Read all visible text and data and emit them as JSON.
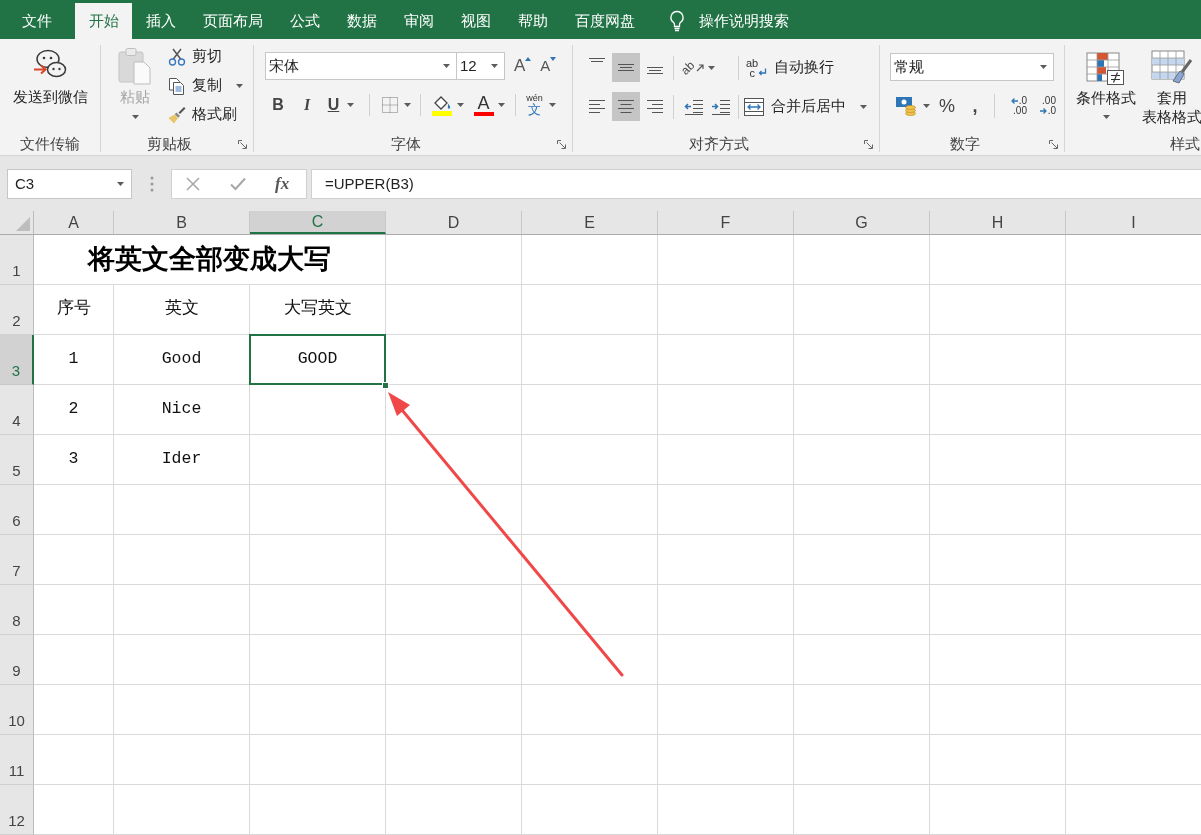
{
  "tabs": [
    {
      "label": "文件",
      "selected": false
    },
    {
      "label": "开始",
      "selected": true
    },
    {
      "label": "插入",
      "selected": false
    },
    {
      "label": "页面布局",
      "selected": false
    },
    {
      "label": "公式",
      "selected": false
    },
    {
      "label": "数据",
      "selected": false
    },
    {
      "label": "审阅",
      "selected": false
    },
    {
      "label": "视图",
      "selected": false
    },
    {
      "label": "帮助",
      "selected": false
    },
    {
      "label": "百度网盘",
      "selected": false
    }
  ],
  "tell_me": {
    "label": "操作说明搜索"
  },
  "ribbon": {
    "file_transfer": {
      "title": "文件传输",
      "send_to_wechat": "发送到微信"
    },
    "clipboard": {
      "title": "剪贴板",
      "paste": {
        "label": "粘贴",
        "disabled": true
      },
      "cut": "剪切",
      "copy": "复制",
      "format_painter": "格式刷"
    },
    "font": {
      "title": "字体",
      "font_name": "宋体",
      "font_size": "12",
      "grow_font": "A",
      "shrink_font": "A",
      "bold": "B",
      "italic": "I",
      "underline": "U",
      "font_color": "A",
      "phonetic_guide": {
        "ruby": "wén",
        "base": "文"
      }
    },
    "alignment": {
      "title": "对齐方式",
      "vertical": [
        {
          "kind": "top",
          "selected": false
        },
        {
          "kind": "middle",
          "selected": true
        },
        {
          "kind": "bottom",
          "selected": false
        }
      ],
      "horizontal": [
        {
          "kind": "left",
          "selected": false
        },
        {
          "kind": "center",
          "selected": true
        },
        {
          "kind": "right",
          "selected": false
        }
      ],
      "orientation": "ab",
      "wrap_text": {
        "icon_text": [
          "ab",
          "c"
        ],
        "label": "自动换行"
      },
      "merge_center": "合并后居中"
    },
    "number": {
      "title": "数字",
      "format": "常规",
      "percent": "%",
      "comma": ",",
      "increase_decimal": [
        ".0",
        ".00"
      ],
      "decrease_decimal": [
        ".00",
        ".0"
      ]
    },
    "styles": {
      "title": "样式",
      "conditional_formatting": "条件格式",
      "format_as_table": [
        "套用",
        "表格格式"
      ]
    }
  },
  "formula_bar": {
    "name_box": "C3",
    "function_button": "fx",
    "formula": "=UPPER(B3)"
  },
  "sheet": {
    "columns": [
      {
        "label": "A",
        "selected": false
      },
      {
        "label": "B",
        "selected": false
      },
      {
        "label": "C",
        "selected": true
      },
      {
        "label": "D",
        "selected": false
      },
      {
        "label": "E",
        "selected": false
      },
      {
        "label": "F",
        "selected": false
      },
      {
        "label": "G",
        "selected": false
      },
      {
        "label": "H",
        "selected": false
      },
      {
        "label": "I",
        "selected": false
      }
    ],
    "rows": [
      {
        "label": "1",
        "selected": false,
        "title": "将英文全部变成大写"
      },
      {
        "label": "2",
        "selected": false,
        "cells": [
          {
            "text": "序号",
            "selected": false
          },
          {
            "text": "英文",
            "selected": false
          },
          {
            "text": "大写英文",
            "selected": false
          }
        ]
      },
      {
        "label": "3",
        "selected": true,
        "cells": [
          {
            "text": "1",
            "selected": false
          },
          {
            "text": "Good",
            "selected": false
          },
          {
            "text": "GOOD",
            "selected": true
          }
        ]
      },
      {
        "label": "4",
        "selected": false,
        "cells": [
          {
            "text": "2",
            "selected": false
          },
          {
            "text": "Nice",
            "selected": false
          }
        ]
      },
      {
        "label": "5",
        "selected": false,
        "cells": [
          {
            "text": "3",
            "selected": false
          },
          {
            "text": "Ider",
            "selected": false
          }
        ]
      },
      {
        "label": "6",
        "selected": false
      },
      {
        "label": "7",
        "selected": false
      },
      {
        "label": "8",
        "selected": false
      },
      {
        "label": "9",
        "selected": false
      },
      {
        "label": "10",
        "selected": false
      },
      {
        "label": "11",
        "selected": false
      },
      {
        "label": "12",
        "selected": false
      }
    ]
  }
}
